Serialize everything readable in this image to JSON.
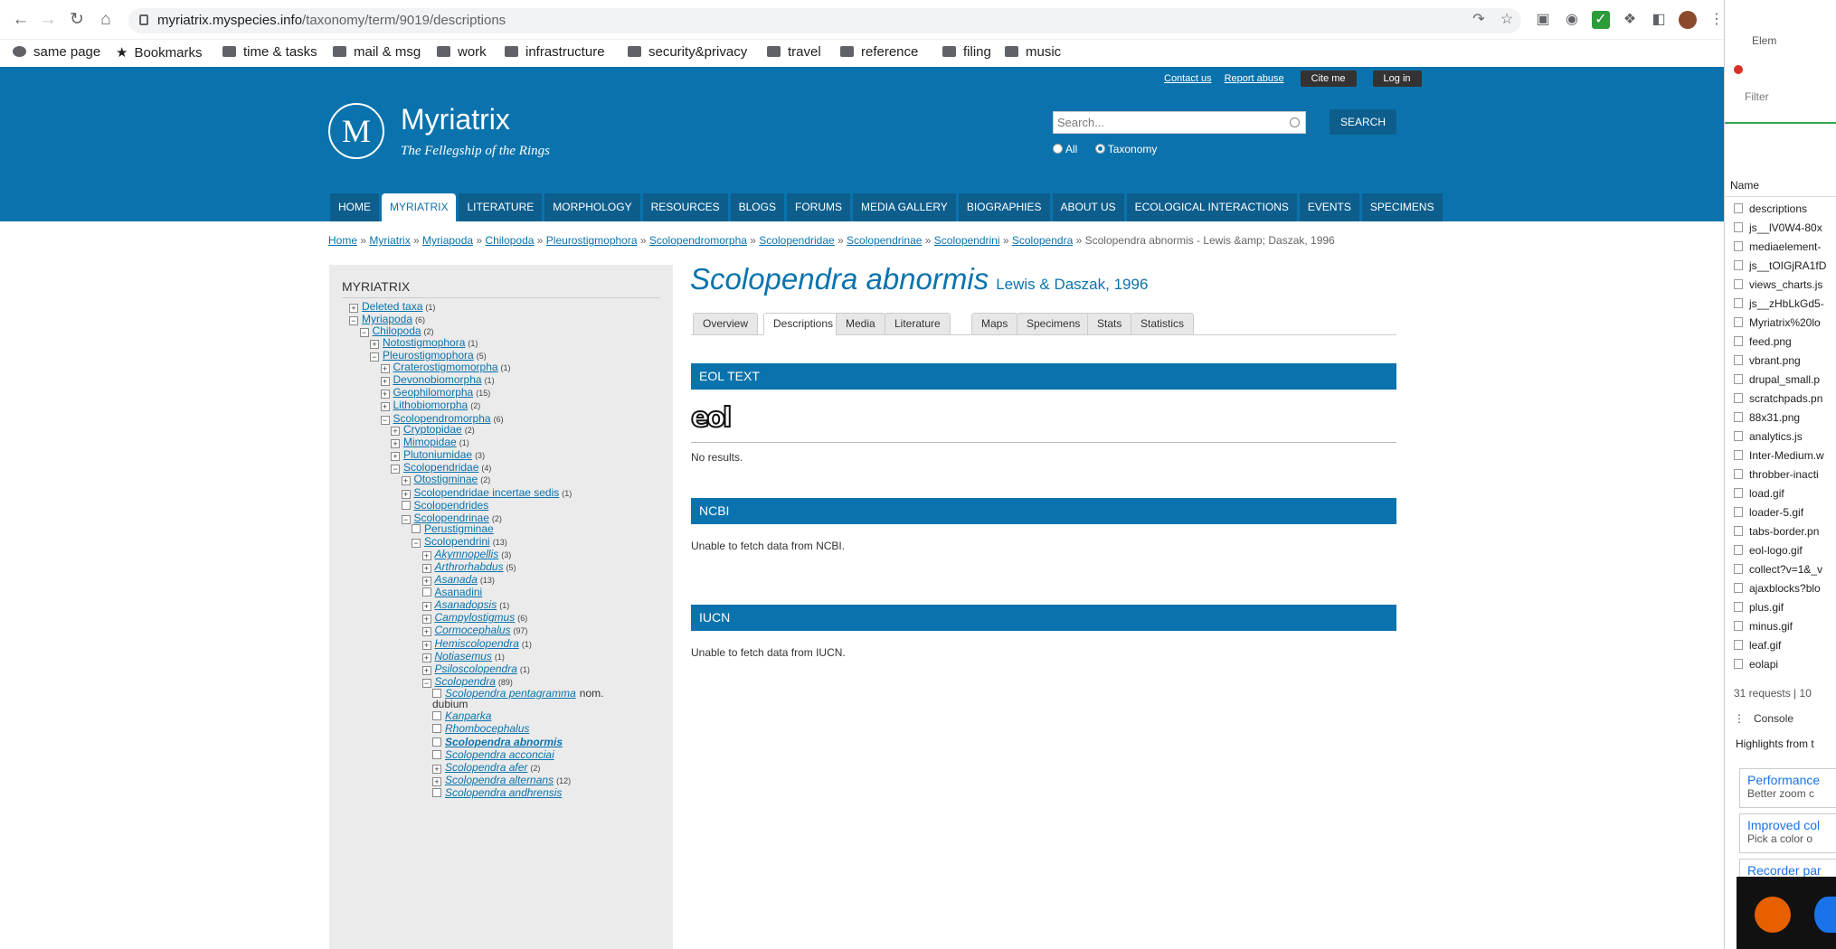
{
  "browser": {
    "url_host": "myriatrix.myspecies.info",
    "url_path": "/taxonomy/term/9019/descriptions",
    "bookmarks": [
      "same page",
      "Bookmarks",
      "time & tasks",
      "mail & msg",
      "work",
      "infrastructure",
      "security&privacy",
      "travel",
      "reference",
      "filing",
      "music"
    ]
  },
  "site": {
    "toplinks": [
      "Contact us",
      "Report abuse"
    ],
    "cite": "Cite me",
    "login": "Log in",
    "logo_letter": "M",
    "name": "Myriatrix",
    "slogan": "The Fellegship of the Rings",
    "search_placeholder": "Search...",
    "search_button": "SEARCH",
    "radio_all": "All",
    "radio_taxonomy": "Taxonomy",
    "menu": [
      "HOME",
      "MYRIATRIX",
      "LITERATURE",
      "MORPHOLOGY",
      "RESOURCES",
      "BLOGS",
      "FORUMS",
      "MEDIA GALLERY",
      "BIOGRAPHIES",
      "ABOUT US",
      "ECOLOGICAL INTERACTIONS",
      "EVENTS",
      "SPECIMENS"
    ]
  },
  "breadcrumb": {
    "links": [
      "Home",
      "Myriatrix",
      "Myriapoda",
      "Chilopoda",
      "Pleurostigmophora",
      "Scolopendromorpha",
      "Scolopendridae",
      "Scolopendrinae",
      "Scolopendrini",
      "Scolopendra"
    ],
    "current": "Scolopendra abnormis - Lewis &amp; Daszak, 1996"
  },
  "sidebar": {
    "title": "MYRIATRIX",
    "tree": [
      {
        "label": "Deleted taxa",
        "count": "(1)",
        "box": "+"
      },
      {
        "label": "Myriapoda",
        "count": "(6)",
        "box": "-"
      },
      {
        "label": "Chilopoda",
        "count": "(2)",
        "box": "-"
      },
      {
        "label": "Notostigmophora",
        "count": "(1)",
        "box": "+"
      },
      {
        "label": "Pleurostigmophora",
        "count": "(5)",
        "box": "-"
      },
      {
        "label": "Craterostigmomorpha",
        "count": "(1)",
        "box": "+"
      },
      {
        "label": "Devonobiomorpha",
        "count": "(1)",
        "box": "+"
      },
      {
        "label": "Geophilomorpha",
        "count": "(15)",
        "box": "+"
      },
      {
        "label": "Lithobiomorpha",
        "count": "(2)",
        "box": "+"
      },
      {
        "label": "Scolopendromorpha",
        "count": "(6)",
        "box": "-"
      },
      {
        "label": "Cryptopidae",
        "count": "(2)",
        "box": "+"
      },
      {
        "label": "Mimopidae",
        "count": "(1)",
        "box": "+"
      },
      {
        "label": "Plutoniumidae",
        "count": "(3)",
        "box": "+"
      },
      {
        "label": "Scolopendridae",
        "count": "(4)",
        "box": "-"
      },
      {
        "label": "Otostigminae",
        "count": "(2)",
        "box": "+"
      },
      {
        "label": "Scolopendridae incertae sedis",
        "count": "(1)",
        "box": "+"
      },
      {
        "label": "Scolopendrides",
        "count": "",
        "box": ""
      },
      {
        "label": "Scolopendrinae",
        "count": "(2)",
        "box": "-"
      },
      {
        "label": "Perustigminae",
        "count": "",
        "box": ""
      },
      {
        "label": "Scolopendrini",
        "count": "(13)",
        "box": "-"
      },
      {
        "label": "Akymnopellis",
        "count": "(3)",
        "box": "+"
      },
      {
        "label": "Arthrorhabdus",
        "count": "(5)",
        "box": "+"
      },
      {
        "label": "Asanada",
        "count": "(13)",
        "box": "+"
      },
      {
        "label": "Asanadini",
        "count": "",
        "box": ""
      },
      {
        "label": "Asanadopsis",
        "count": "(1)",
        "box": "+"
      },
      {
        "label": "Campylostigmus",
        "count": "(6)",
        "box": "+"
      },
      {
        "label": "Cormocephalus",
        "count": "(97)",
        "box": "+"
      },
      {
        "label": "Hemiscolopendra",
        "count": "(1)",
        "box": "+"
      },
      {
        "label": "Notiasemus",
        "count": "(1)",
        "box": "+"
      },
      {
        "label": "Psiloscolopendra",
        "count": "(1)",
        "box": "+"
      },
      {
        "label": "Scolopendra",
        "count": "(89)",
        "box": "-"
      },
      {
        "label": "Scolopendra pentagramma",
        "count": "",
        "box": "",
        "suffix": "nom."
      },
      {
        "label": "Kanparka",
        "count": "",
        "box": ""
      },
      {
        "label": "Rhombocephalus",
        "count": "",
        "box": ""
      },
      {
        "label": "Scolopendra abnormis",
        "count": "",
        "box": ""
      },
      {
        "label": "Scolopendra acconciai",
        "count": "",
        "box": ""
      },
      {
        "label": "Scolopendra afer",
        "count": "(2)",
        "box": "+"
      },
      {
        "label": "Scolopendra alternans",
        "count": "(12)",
        "box": "+"
      },
      {
        "label": "Scolopendra andhrensis",
        "count": "",
        "box": ""
      }
    ],
    "dubium": "dubium"
  },
  "main": {
    "species": "Scolopendra abnormis",
    "authority": "Lewis & Daszak, 1996",
    "tabs": [
      "Overview",
      "Descriptions",
      "Media",
      "Literature",
      "Maps",
      "Specimens",
      "Stats",
      "Statistics"
    ],
    "eol_title": "EOL TEXT",
    "eol_logo": "eol",
    "eol_msg": "No results.",
    "ncbi_title": "NCBI",
    "ncbi_msg": "Unable to fetch data from NCBI.",
    "iucn_title": "IUCN",
    "iucn_msg": "Unable to fetch data from IUCN."
  },
  "devtools": {
    "tab": "Elem",
    "filter": "Filter",
    "name_header": "Name",
    "files": [
      "descriptions",
      "js__lV0W4-80x",
      "mediaelement-",
      "js__tOIGjRA1fD",
      "views_charts.js",
      "js__zHbLkGd5-",
      "Myriatrix%20lo",
      "feed.png",
      "vbrant.png",
      "drupal_small.p",
      "scratchpads.pn",
      "88x31.png",
      "analytics.js",
      "Inter-Medium.w",
      "throbber-inacti",
      "load.gif",
      "loader-5.gif",
      "tabs-border.pn",
      "eol-logo.gif",
      "collect?v=1&_v",
      "ajaxblocks?blo",
      "plus.gif",
      "minus.gif",
      "leaf.gif",
      "eolapi"
    ],
    "requests": "31 requests",
    "requests_extra": "10",
    "console_tab": "Console",
    "highlights": "Highlights from t",
    "cards": [
      {
        "title": "Performance",
        "desc": "Better zoom c"
      },
      {
        "title": "Improved col",
        "desc": "Pick a color o"
      },
      {
        "title": "Recorder par",
        "desc": ""
      }
    ]
  }
}
